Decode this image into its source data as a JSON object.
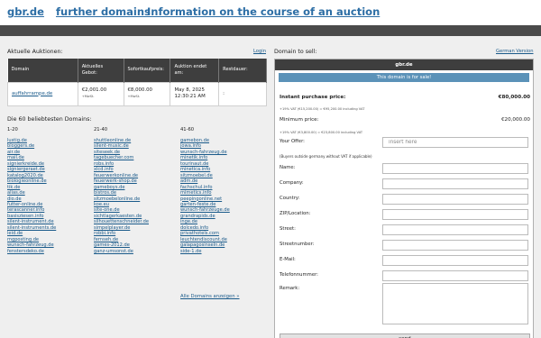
{
  "nav": {
    "home": "gbr.de",
    "further_domains": "further domains",
    "auction_info": "Information on the course of an auction"
  },
  "auctions": {
    "title": "Aktuelle Auktionen:",
    "login": "Login",
    "headers": [
      "Domain",
      "Aktuelles Gebot:",
      "Sofortkaufpreis:",
      "Auktion endet am:",
      "Restdauer:"
    ],
    "rows": [
      {
        "domain": "auffahrrampe.de",
        "current_bid": "€2,001.00",
        "current_bid_vat": "+MwSt.",
        "buy_now": "€8,000.00",
        "buy_now_vat": "+MwSt.",
        "ends": "May 8, 2025 12:30:21 AM",
        "remaining": ":"
      }
    ]
  },
  "top_domains": {
    "title": "Die 60 beliebtesten Domains:",
    "col1_header": "1-20",
    "col2_header": "21-40",
    "col3_header": "41-60",
    "col1": [
      "lustig.de",
      "bloggers.de",
      "air.de",
      "mail.de",
      "signierkreide.de",
      "signiergeraet.de",
      "katalog2020.de",
      "biologieonline.de",
      "tik.de",
      "alias.de",
      "dio.de",
      "futter-online.de",
      "terascanner.info",
      "basisziesen.info",
      "silent-instrument.de",
      "silent-instruments.de",
      "leid.de",
      "mgposting.de",
      "wunsch-fahrzeug.de",
      "fenstersdeko.de"
    ],
    "col2": [
      "shuttleonline.de",
      "silent-music.de",
      "siteseek.de",
      "tagebuecher.com",
      "robs.info",
      "xlcd.info",
      "feuerwerkonline.de",
      "feuerwerk-shop.de",
      "gameboys.de",
      "bistros.de",
      "sitzmoebelonline.de",
      "koe.eu",
      "site-one.de",
      "sichtlagerkaesten.de",
      "silhouettenschneider.de",
      "simpelplayer.de",
      "robbi.info",
      "fernseh.de",
      "games-2012.de",
      "ganz-umsonst.de"
    ],
    "col3": [
      "gamebon.de",
      "jowa.info",
      "wunsch-fahrzeug.de",
      "minetik.info",
      "tourinaut.de",
      "minetica.info",
      "sitzmoebel.de",
      "adm.de",
      "fachschul.info",
      "mimetics.info",
      "peepingonline.net",
      "garten-feste.de",
      "wunsch-fahrzeuge.de",
      "grandrapids.de",
      "inge.de",
      "dolcedo.info",
      "privathotels.com",
      "leuchtendiscount.de",
      "galapagosinseln.de",
      "side-1.de"
    ],
    "all_link": "Alle Domains anzeigen »"
  },
  "sell": {
    "title": "Domain to sell:",
    "language_link": "German Version",
    "domain": "gbr.de",
    "banner": "This domain is for sale!",
    "instant_label": "Instant purchase price:",
    "instant_value": "€80,000.00",
    "instant_note": "+19% VAT (€15,200.00) = €95,200.00 including VAT",
    "min_label": "Minimum price:",
    "min_value": "€20,000.00",
    "min_note": "+19% VAT (€3,800.00) = €23,800.00 including VAT",
    "offer_label": "Your Offer:",
    "offer_placeholder": "insert here",
    "offer_note": "(Buyers outside germany without VAT if applicable)",
    "fields": [
      "Name:",
      "Company:",
      "Country:",
      "ZIP/Location:",
      "Street:",
      "Streetnumber:",
      "E-Mail:",
      "Telefonnummer:"
    ],
    "remark_label": "Remark:",
    "send_label": "send"
  }
}
